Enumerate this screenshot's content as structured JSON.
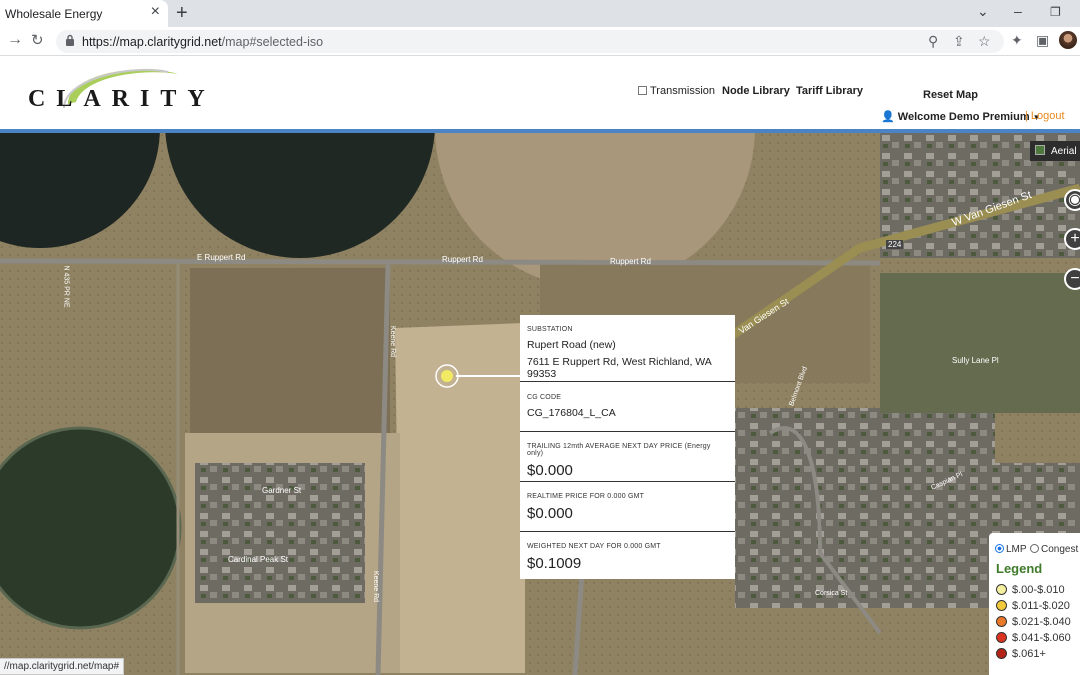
{
  "browser": {
    "tab_title": "Wholesale Energy",
    "url_host": "https://map.claritygrid.net",
    "url_path": "/map#selected-iso"
  },
  "header": {
    "logo_text": "CLARITY",
    "transmission_label": "Transmission",
    "node_library": "Node Library",
    "tariff_library": "Tariff Library",
    "reset_map": "Reset Map",
    "welcome": "Welcome Demo Premium",
    "logout": "Logout"
  },
  "map": {
    "street_labels": [
      "E Ruppert Rd",
      "Ruppert Rd",
      "Ruppert Rd",
      "Van Giesen St",
      "W Van Giesen St",
      "Keene Rd",
      "Keene Rd",
      "Gardner St",
      "Cardinal Peak St",
      "Sully Lane Pl",
      "Belmont Blvd",
      "Corsica St",
      "Caspian Pl",
      "N 435 PR NE",
      "224"
    ],
    "view_toggle": "Aerial",
    "status_url": "//map.claritygrid.net/map#",
    "marker_color": "#f2ea62"
  },
  "popup": {
    "substation_label": "SUBSTATION",
    "substation_name": "Rupert Road (new)",
    "address": "7611 E Ruppert Rd, West Richland, WA 99353",
    "cg_code_label": "CG CODE",
    "cg_code": "CG_176804_L_CA",
    "trailing_label": "TRAILING 12mth AVERAGE NEXT DAY PRICE (Energy only)",
    "trailing_value": "$0.000",
    "realtime_label": "REALTIME PRICE FOR 0.000 GMT",
    "realtime_value": "$0.000",
    "weighted_label": "WEIGHTED NEXT DAY FOR 0.000 GMT",
    "weighted_value": "$0.1009"
  },
  "legend": {
    "lmp_label": "LMP",
    "congest_label": "Congest",
    "title": "Legend",
    "items": [
      {
        "label": "$.00-$.010",
        "color": "#f5f0a0"
      },
      {
        "label": "$.011-$.020",
        "color": "#f2c93a"
      },
      {
        "label": "$.021-$.040",
        "color": "#ea7a2a"
      },
      {
        "label": "$.041-$.060",
        "color": "#dd3322"
      },
      {
        "label": "$.061+",
        "color": "#b32217"
      }
    ]
  }
}
